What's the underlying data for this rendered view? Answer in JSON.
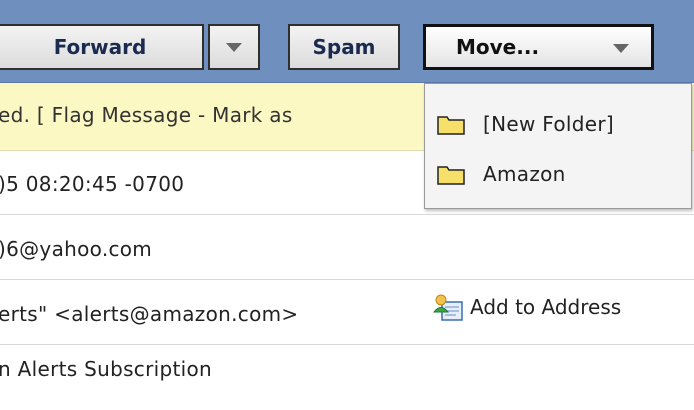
{
  "toolbar": {
    "forward_label": "Forward",
    "spam_label": "Spam",
    "move_label": "Move..."
  },
  "move_menu": {
    "items": [
      {
        "label": "[New Folder]",
        "icon": "folder-icon"
      },
      {
        "label": "Amazon",
        "icon": "folder-icon"
      }
    ]
  },
  "message": {
    "flag_text": "ed. [ Flag Message - Mark as",
    "date_text": ")5 08:20:45 -0700",
    "to_text": ")6@yahoo.com",
    "from_text": "erts\" <alerts@amazon.com>",
    "add_to_address": "Add to Address",
    "subject_text": "n Alerts Subscription"
  },
  "colors": {
    "toolbar_bg": "#6f8fbf",
    "flag_bar_bg": "#fbf8c4",
    "button_text": "#1b2b4f",
    "folder_fill": "#f6e06a"
  }
}
